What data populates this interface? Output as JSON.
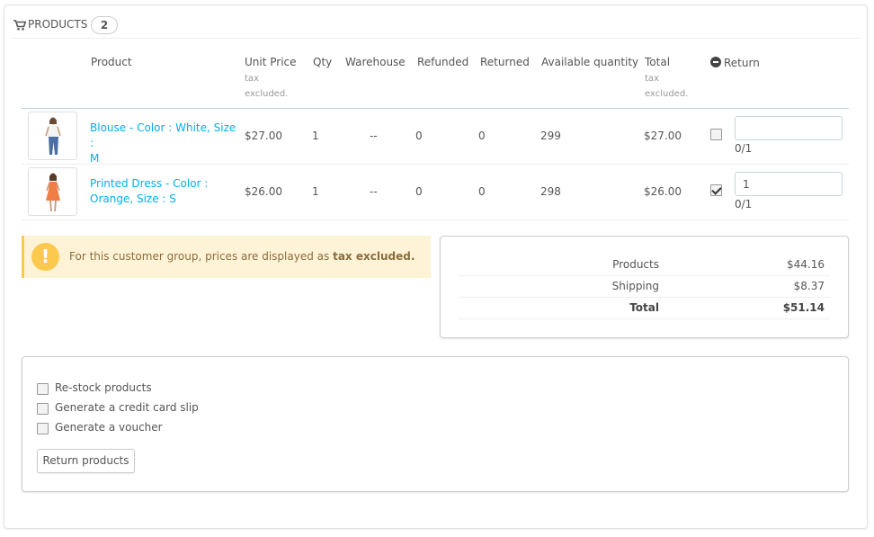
{
  "panel": {
    "title": "Products",
    "count": "2"
  },
  "table": {
    "headers": {
      "product": "Product",
      "unit_price": "Unit Price",
      "unit_price_sub1": "tax",
      "unit_price_sub2": "excluded.",
      "qty": "Qty",
      "warehouse": "Warehouse",
      "refunded": "Refunded",
      "returned": "Returned",
      "available": "Available quantity",
      "total": "Total",
      "total_sub1": "tax",
      "total_sub2": "excluded.",
      "return": "Return"
    },
    "rows": [
      {
        "name_line1": "Blouse - Color : White, Size :",
        "name_line2": "M",
        "unit_price": "$27.00",
        "qty": "1",
        "warehouse": "--",
        "refunded": "0",
        "returned": "0",
        "available": "299",
        "total": "$27.00",
        "return_checked": false,
        "return_qty": "",
        "return_max": "0/1"
      },
      {
        "name_line1": "Printed Dress - Color :",
        "name_line2": "Orange, Size : S",
        "unit_price": "$26.00",
        "qty": "1",
        "warehouse": "--",
        "refunded": "0",
        "returned": "0",
        "available": "298",
        "total": "$26.00",
        "return_checked": true,
        "return_qty": "1",
        "return_max": "0/1"
      }
    ]
  },
  "alert": {
    "text": "For this customer group, prices are displayed as",
    "strong": "tax excluded."
  },
  "totals": {
    "products_label": "Products",
    "products_value": "$44.16",
    "shipping_label": "Shipping",
    "shipping_value": "$8.37",
    "total_label": "Total",
    "total_value": "$51.14"
  },
  "options": {
    "restock": "Re-stock products",
    "credit_slip": "Generate a credit card slip",
    "voucher": "Generate a voucher",
    "button": "Return products"
  },
  "colors": {
    "link": "#00aff0",
    "alert_bg": "#fff3d7",
    "alert_icon": "#fcc94f"
  }
}
